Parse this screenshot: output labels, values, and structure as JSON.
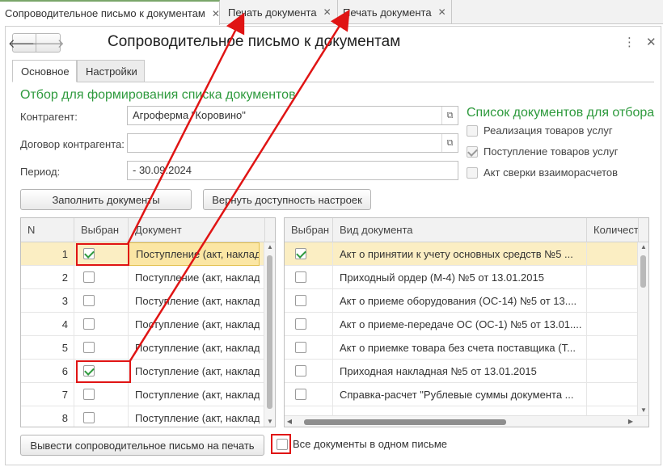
{
  "tabs": [
    {
      "label": "Сопроводительное письмо к документам",
      "close": "✕"
    },
    {
      "label": "Печать документа",
      "close": "✕"
    },
    {
      "label": "Печать документа",
      "close": "✕"
    }
  ],
  "form": {
    "back": "🡐",
    "forward": "🡒",
    "title": "Сопроводительное письмо к документам",
    "more_icon": "⋮",
    "close_icon": "✕"
  },
  "inner_tabs": [
    "Основное",
    "Настройки"
  ],
  "filter": {
    "title": "Отбор для формирования списка документов",
    "counterparty_label": "Контрагент:",
    "counterparty_value": "Агроферма \"Коровино\"",
    "contract_label": "Договор контрагента:",
    "contract_value": "",
    "period_label": "Период:",
    "period_value": "- 30.09.2024",
    "field_btn": "⧉"
  },
  "doc_filter": {
    "title": "Список документов для отбора",
    "options": [
      {
        "label": "Реализация товаров услуг",
        "checked": false
      },
      {
        "label": "Поступление товаров услуг",
        "checked": true
      },
      {
        "label": "Акт сверки взаиморасчетов",
        "checked": false
      }
    ]
  },
  "buttons": {
    "fill": "Заполнить документы",
    "restore": "Вернуть доступность настроек",
    "print": "Вывести сопроводительное письмо на печать"
  },
  "left_grid": {
    "headers": [
      "N",
      "Выбран",
      "Документ"
    ],
    "rows": [
      {
        "n": "1",
        "checked": true,
        "doc": "Поступление (акт, накладная)"
      },
      {
        "n": "2",
        "checked": false,
        "doc": "Поступление (акт, накладная)"
      },
      {
        "n": "3",
        "checked": false,
        "doc": "Поступление (акт, накладная)"
      },
      {
        "n": "4",
        "checked": false,
        "doc": "Поступление (акт, накладная)"
      },
      {
        "n": "5",
        "checked": false,
        "doc": "Поступление (акт, накладная)"
      },
      {
        "n": "6",
        "checked": true,
        "doc": "Поступление (акт, накладная)"
      },
      {
        "n": "7",
        "checked": false,
        "doc": "Поступление (акт, накладная)"
      },
      {
        "n": "8",
        "checked": false,
        "doc": "Поступление (акт, накладная)"
      }
    ]
  },
  "right_grid": {
    "headers": [
      "Выбран",
      "Вид документа",
      "Количест"
    ],
    "rows": [
      {
        "checked": true,
        "doc": "Акт о принятии к учету основных средств №5 ..."
      },
      {
        "checked": false,
        "doc": "Приходный ордер (М-4) №5 от 13.01.2015"
      },
      {
        "checked": false,
        "doc": "Акт о приеме оборудования (ОС-14) №5 от 13...."
      },
      {
        "checked": false,
        "doc": "Акт о приеме-передаче ОС (ОС-1) №5 от 13.01...."
      },
      {
        "checked": false,
        "doc": "Акт о приемке товара без счета поставщика (Т..."
      },
      {
        "checked": false,
        "doc": "Приходная накладная №5 от 13.01.2015"
      },
      {
        "checked": false,
        "doc": "Справка-расчет \"Рублевые суммы документа ..."
      }
    ]
  },
  "all_in_one": {
    "label": "Все документы в одном письме",
    "checked": false
  },
  "colors": {
    "accent_green": "#2e9a3d",
    "annotation_red": "#e01414",
    "selection": "#fbeec3"
  }
}
